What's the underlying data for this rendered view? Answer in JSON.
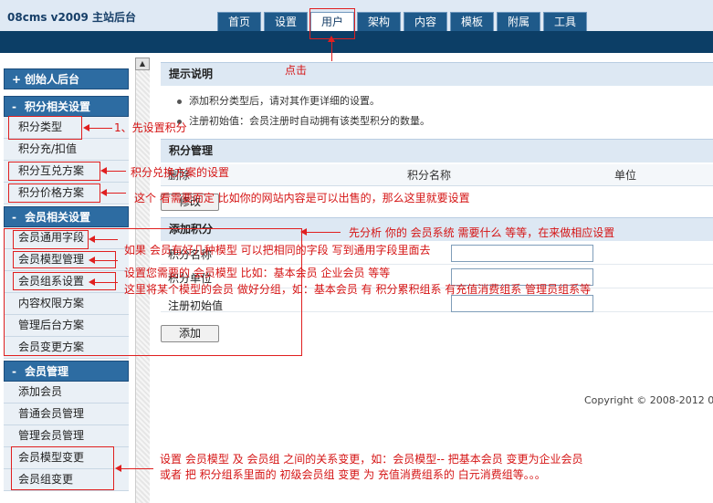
{
  "brand": "08cms  v2009  主站后台",
  "nav": {
    "tabs": [
      "首页",
      "设置",
      "用户",
      "架构",
      "内容",
      "模板",
      "附属",
      "工具"
    ],
    "active": "用户"
  },
  "sidebar": {
    "creator": "创始人后台",
    "points_group": {
      "title": "积分相关设置",
      "items": [
        "积分类型",
        "积分充/扣值",
        "积分互兑方案",
        "积分价格方案"
      ]
    },
    "member_group": {
      "title": "会员相关设置",
      "items": [
        "会员通用字段",
        "会员模型管理",
        "会员组系设置",
        "内容权限方案",
        "管理后台方案",
        "会员变更方案"
      ]
    },
    "manage_group": {
      "title": "会员管理",
      "items": [
        "添加会员",
        "普通会员管理",
        "管理会员管理",
        "会员模型变更",
        "会员组变更"
      ]
    },
    "scroll_up": "▲"
  },
  "main": {
    "tips": {
      "title": "提示说明",
      "lines": [
        "添加积分类型后，请对其作更详细的设置。",
        "注册初始值：会员注册时自动拥有该类型积分的数量。"
      ]
    },
    "manage": {
      "title": "积分管理",
      "columns": [
        "删除",
        "积分名称",
        "单位"
      ],
      "modify_button": "修改"
    },
    "add": {
      "title": "添加积分",
      "fields": [
        "积分名称",
        "积分单位",
        "注册初始值"
      ],
      "add_button": "添加"
    },
    "footer": "Copyright © 2008-2012 0"
  },
  "annotations": {
    "click": "点击",
    "step1": "1、先设置积分",
    "exchange": "积分兑换方案的设置",
    "price": "这个  看需要而定  比如你的网站内容是可以出售的，那么这里就要设置",
    "analyze": "先分析  你的  会员系统   需要什么  等等，在来做相应设置",
    "common_fields": "如果  会员有好几种模型  可以把相同的字段  写到通用字段里面去",
    "models": "设置您需要的  会员模型  比如：基本会员  企业会员  等等",
    "groups": "这里将某个模型的会员  做好分组，如：基本会员  有  积分累积组系  有充值消费组系  管理员组系等",
    "change_line1": "设置  会员模型  及  会员组  之间的关系变更，如：会员模型-- 把基本会员  变更为企业会员",
    "change_line2": "或者  把  积分组系里面的  初级会员组  变更  为  充值消费组系的  白元消费组等。。。"
  }
}
